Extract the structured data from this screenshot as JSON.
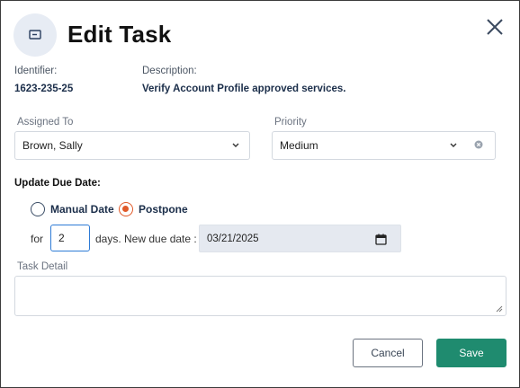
{
  "dialog": {
    "title": "Edit Task"
  },
  "info": {
    "identifier_label": "Identifier:",
    "identifier_value": "1623-235-25",
    "description_label": "Description:",
    "description_value": "Verify Account Profile approved services."
  },
  "assigned_to": {
    "label": "Assigned To",
    "value": "Brown, Sally"
  },
  "priority": {
    "label": "Priority",
    "value": "Medium"
  },
  "due_date": {
    "section_title": "Update Due Date:",
    "option_manual": "Manual Date",
    "option_postpone": "Postpone",
    "selected": "Postpone",
    "for_label": "for",
    "days_value": "2",
    "days_suffix": "days. New due date :",
    "new_due_date": "03/21/2025"
  },
  "task_detail": {
    "label": "Task Detail",
    "value": ""
  },
  "buttons": {
    "cancel": "Cancel",
    "save": "Save"
  },
  "colors": {
    "accent": "#e05a2a",
    "save": "#1f8b6f",
    "focus": "#2e7bd6"
  },
  "icons": {
    "header": "screen-icon",
    "close": "close-icon",
    "dropdown": "chevron-down-icon",
    "clear": "clear-icon",
    "calendar": "calendar-icon"
  }
}
